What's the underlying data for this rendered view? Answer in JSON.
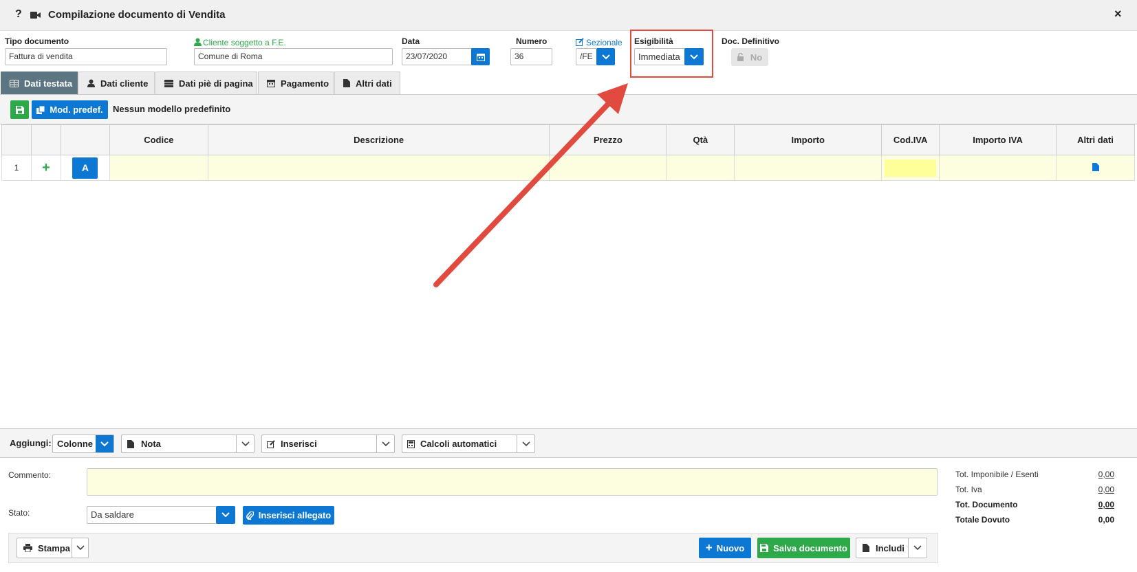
{
  "window": {
    "title": "Compilazione documento di Vendita",
    "help_glyph": "?",
    "close_glyph": "×"
  },
  "header": {
    "tipo_documento": {
      "label": "Tipo documento",
      "value": "Fattura di vendita"
    },
    "cliente": {
      "label": "Cliente soggetto a F.E.",
      "value": "Comune di Roma"
    },
    "data": {
      "label": "Data",
      "value": "23/07/2020"
    },
    "numero": {
      "label": "Numero",
      "value": "36"
    },
    "sezionale": {
      "label": "Sezionale",
      "value": "/FE"
    },
    "esigibilita": {
      "label": "Esigibilità",
      "value": "Immediata"
    },
    "doc_definitivo": {
      "label": "Doc. Definitivo",
      "value": "No"
    }
  },
  "tabs": [
    {
      "label": "Dati testata",
      "icon": "table-icon",
      "active": true
    },
    {
      "label": "Dati cliente",
      "icon": "user-icon",
      "active": false
    },
    {
      "label": "Dati piè di pagina",
      "icon": "list-icon",
      "active": false
    },
    {
      "label": "Pagamento",
      "icon": "calendar-icon",
      "active": false
    },
    {
      "label": "Altri dati",
      "icon": "file-icon",
      "active": false
    }
  ],
  "toolbar": {
    "mod_predef_label": "Mod. predef.",
    "model_text": "Nessun modello predefinito"
  },
  "grid": {
    "columns": [
      "",
      "",
      "",
      "Codice",
      "Descrizione",
      "Prezzo",
      "Qtà",
      "Importo",
      "Cod.IVA",
      "Importo IVA",
      "Altri dati"
    ],
    "rows": [
      {
        "num": "1",
        "add": "+",
        "type": "A"
      }
    ]
  },
  "aggiungi": {
    "label": "Aggiungi:",
    "colonne": "Colonne",
    "nota": "Nota",
    "inserisci": "Inserisci",
    "calcoli": "Calcoli automatici"
  },
  "footer": {
    "commento_label": "Commento:",
    "stato_label": "Stato:",
    "stato_value": "Da saldare",
    "inserisci_allegato": "Inserisci allegato",
    "stampa": "Stampa",
    "nuovo": "Nuovo",
    "salva": "Salva documento",
    "includi": "Includi"
  },
  "totals": [
    {
      "label": "Tot. Imponibile / Esenti",
      "value": "0,00",
      "bold": false
    },
    {
      "label": "Tot. Iva",
      "value": "0,00",
      "bold": false
    },
    {
      "label": "Tot. Documento",
      "value": "0,00",
      "bold": true
    },
    {
      "label": "Totale Dovuto",
      "value": "0,00",
      "bold": true
    }
  ],
  "colors": {
    "accent": "#0d78d4",
    "success": "#2ea94a",
    "highlight": "#e04a3f",
    "active_tab": "#5b7682"
  }
}
